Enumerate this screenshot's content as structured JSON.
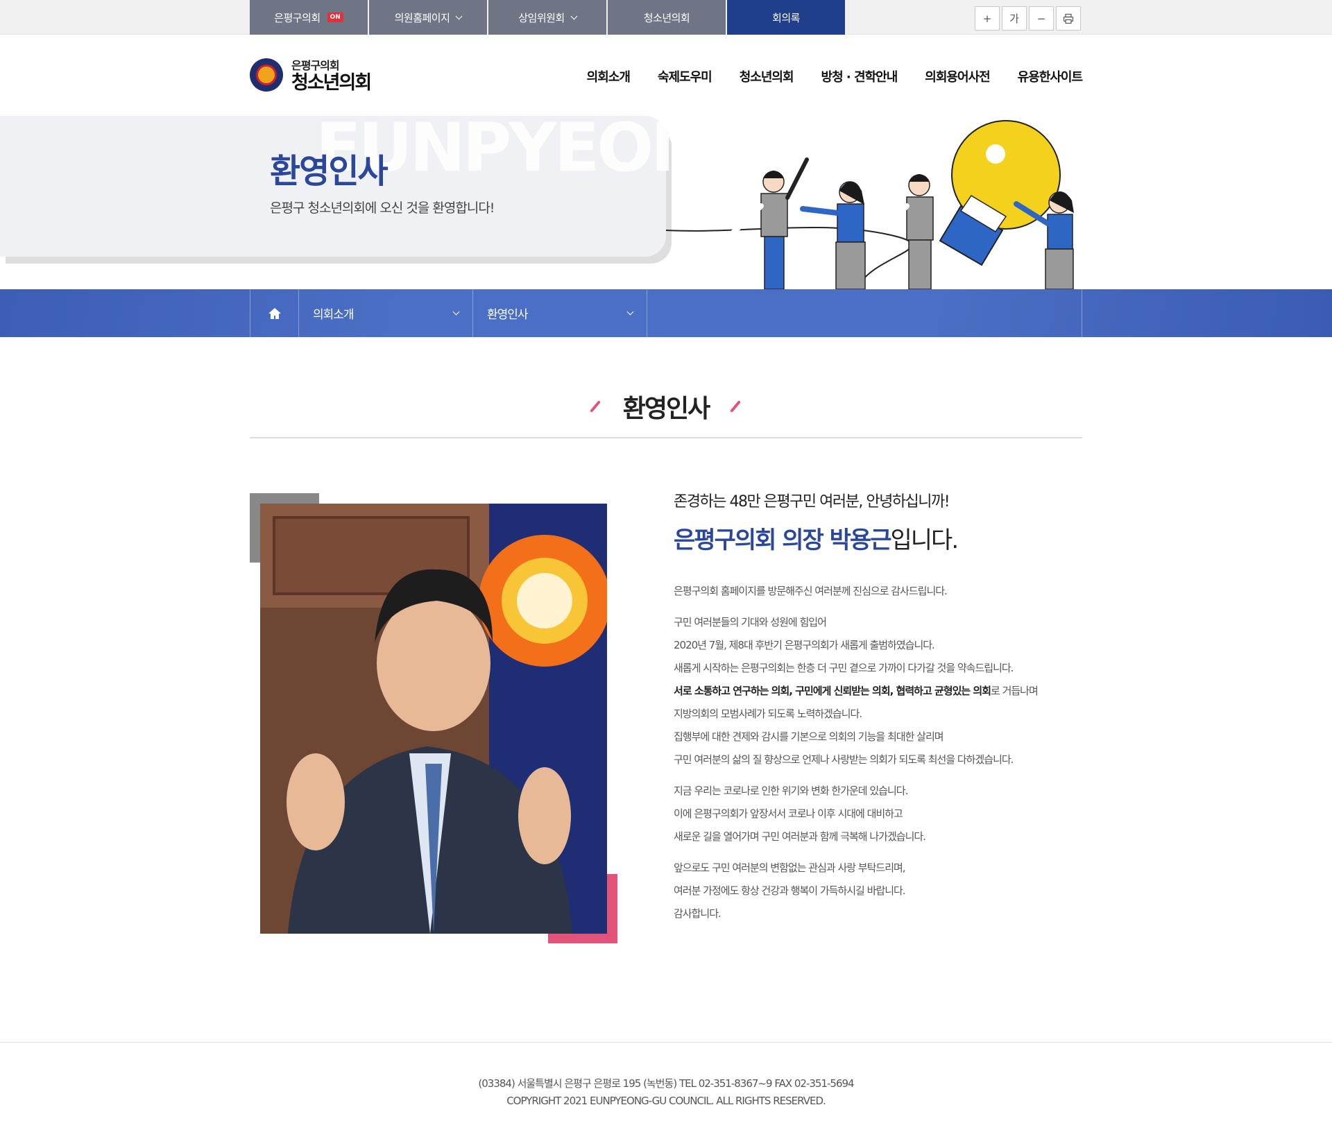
{
  "topnav": {
    "items": [
      {
        "label": "은평구의회",
        "badge": "ON"
      },
      {
        "label": "의원홈페이지"
      },
      {
        "label": "상임위원회"
      },
      {
        "label": "청소년의회"
      },
      {
        "label": "회의록"
      }
    ]
  },
  "tools": {
    "zoom_in": "+",
    "font": "가",
    "zoom_out": "−",
    "print": "print-icon"
  },
  "logo": {
    "line1": "은평구의회",
    "line2": "청소년의회"
  },
  "gnb": [
    "의회소개",
    "숙제도우미",
    "청소년의회",
    "방청 · 견학안내",
    "의회용어사전",
    "유용한사이트"
  ],
  "visual": {
    "watermark": "EUNPYEONG",
    "title": "환영인사",
    "subtitle": "은평구 청소년의회에 오신 것을 환영합니다!"
  },
  "location": {
    "depth1": "의회소개",
    "depth2": "환영인사"
  },
  "content": {
    "title": "환영인사",
    "hello": "존경하는 48만 은평구민 여러분, 안녕하십니까!",
    "name_strong": "은평구의회 의장 박용근",
    "name_tail": "입니다.",
    "p1": [
      "은평구의회 홈페이지를 방문해주신 여러분께 진심으로 감사드립니다."
    ],
    "p2": [
      "구민 여러분들의 기대와 성원에 힘입어",
      "2020년 7월, 제8대 후반기 은평구의회가 새롭게 출범하였습니다.",
      "새롭게 시작하는 은평구의회는 한층 더 구민 곁으로 가까이 다가갈 것을 약속드립니다."
    ],
    "p2_bold": "서로 소통하고 연구하는 의회, 구민에게 신뢰받는 의회, 협력하고 균형있는 의회",
    "p2_bold_tail": "로 거듭나며",
    "p2b": [
      "지방의회의 모범사례가 되도록 노력하겠습니다.",
      "집행부에 대한 견제와 감시를 기본으로 의회의 기능을 최대한 살리며",
      "구민 여러분의 삶의 질 향상으로 언제나 사랑받는 의회가 되도록 최선을 다하겠습니다."
    ],
    "p3": [
      "지금 우리는 코로나로 인한 위기와 변화 한가운데 있습니다.",
      "이에 은평구의회가 앞장서서 코로나 이후 시대에 대비하고",
      "새로운 길을 열어가며 구민 여러분과 함께 극복해 나가겠습니다."
    ],
    "p4": [
      "앞으로도 구민 여러분의 변함없는 관심과 사랑 부탁드리며,",
      "여러분 가정에도 항상 건강과 행복이 가득하시길 바랍니다.",
      "감사합니다."
    ]
  },
  "footer": {
    "address": "(03384) 서울특별시 은평구 은평로 195 (녹번동) TEL 02-351-8367~9 FAX 02-351-5694",
    "copyright": "COPYRIGHT 2021 EUNPYEONG-GU COUNCIL. ALL RIGHTS RESERVED."
  }
}
